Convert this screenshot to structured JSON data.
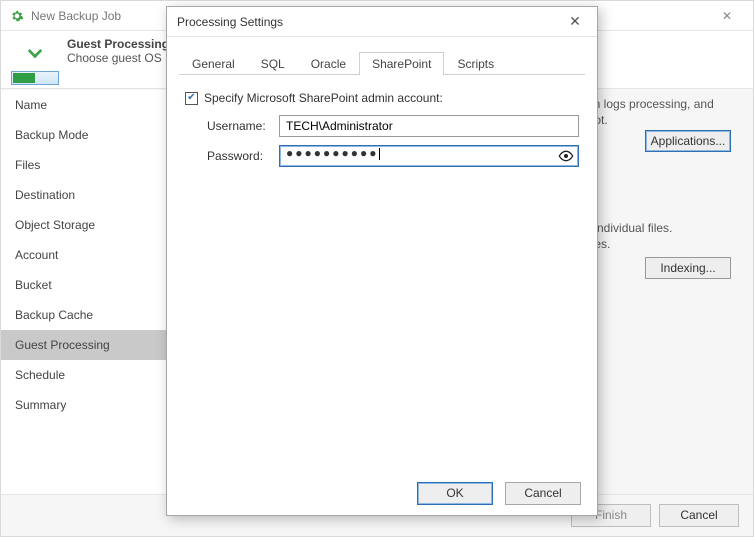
{
  "wizard": {
    "title": "New Backup Job",
    "header_line1": "Guest Processing",
    "header_line2": "Choose guest OS",
    "nav": [
      "Name",
      "Backup Mode",
      "Files",
      "Destination",
      "Object Storage",
      "Account",
      "Bucket",
      "Backup Cache",
      "Guest Processing",
      "Schedule",
      "Summary"
    ],
    "selected_nav_index": 8,
    "right_text1a": "tion logs processing, and",
    "right_text1b": "boot.",
    "applications_btn": "Applications...",
    "right_text2a": "of individual files.",
    "right_text2b": "eries.",
    "indexing_btn": "Indexing...",
    "footer_finish": "Finish",
    "footer_cancel": "Cancel"
  },
  "modal": {
    "title": "Processing Settings",
    "tabs": [
      "General",
      "SQL",
      "Oracle",
      "SharePoint",
      "Scripts"
    ],
    "active_tab_index": 3,
    "checkbox_label": "Specify Microsoft SharePoint admin account:",
    "checkbox_checked": true,
    "username_label": "Username:",
    "username_value": "TECH\\Administrator",
    "password_label": "Password:",
    "password_mask": "●●●●●●●●●●",
    "ok": "OK",
    "cancel": "Cancel"
  }
}
